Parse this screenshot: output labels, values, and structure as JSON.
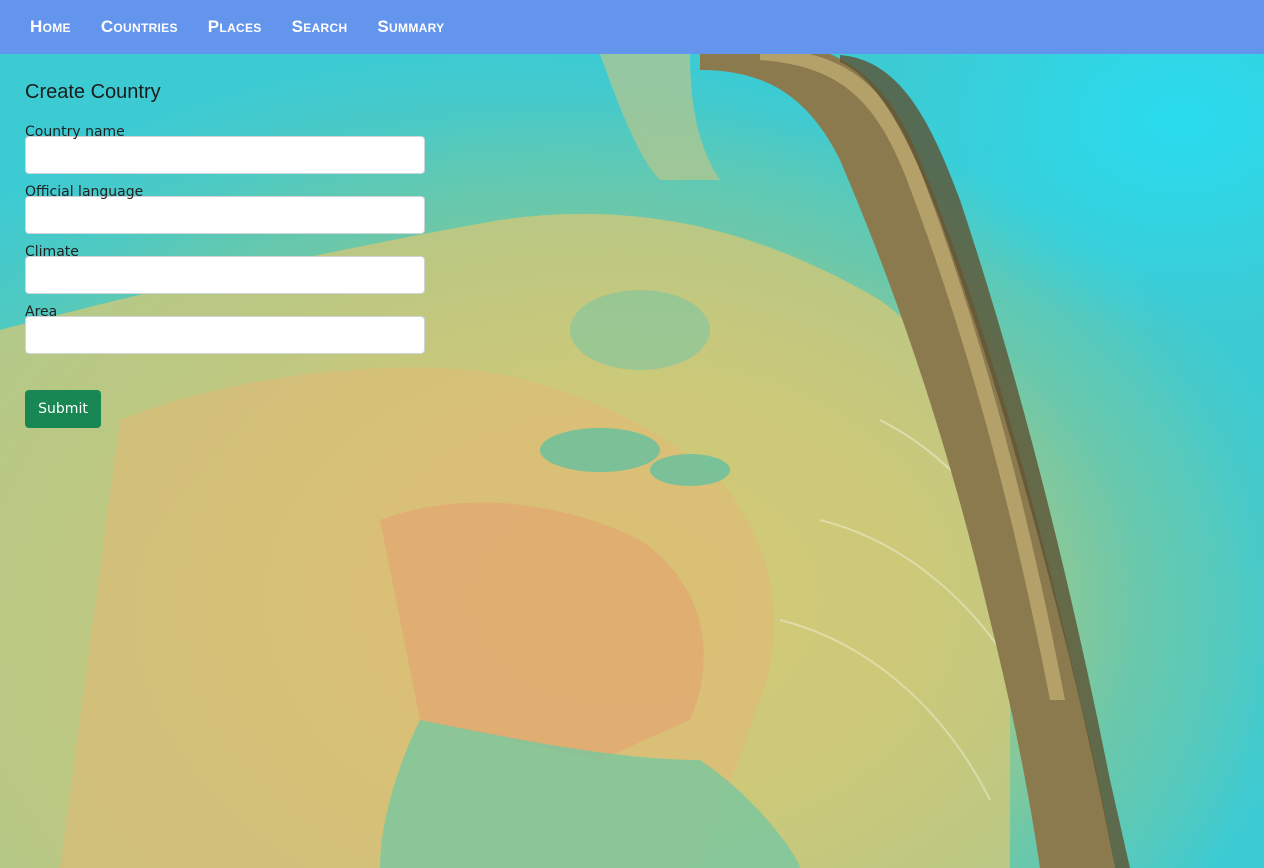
{
  "nav": {
    "items": [
      {
        "label": "Home"
      },
      {
        "label": "Countries"
      },
      {
        "label": "Places"
      },
      {
        "label": "Search"
      },
      {
        "label": "Summary"
      }
    ]
  },
  "form": {
    "title": "Create Country",
    "fields": [
      {
        "label": "Country name",
        "value": ""
      },
      {
        "label": "Official language",
        "value": ""
      },
      {
        "label": "Climate",
        "value": ""
      },
      {
        "label": "Area",
        "value": ""
      }
    ],
    "submit_label": "Submit"
  },
  "colors": {
    "navbar": "#6495ed",
    "submit": "#198754",
    "background_sky": "#22d0e8"
  }
}
